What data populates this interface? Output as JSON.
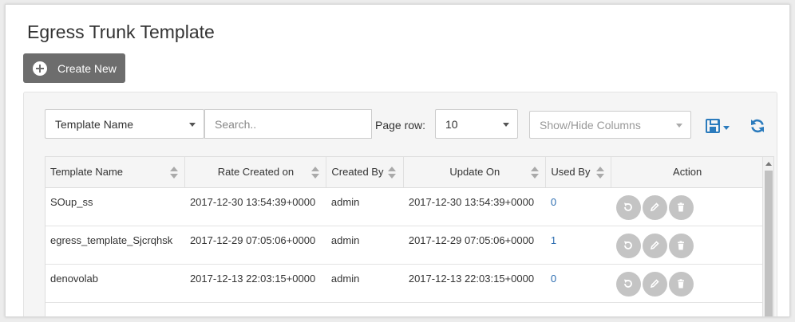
{
  "page": {
    "title": "Egress Trunk Template"
  },
  "toolbar": {
    "create_label": "Create New",
    "filter_field": "Template Name",
    "search_placeholder": "Search..",
    "page_row_label": "Page row:",
    "page_row_value": "10",
    "columns_label": "Show/Hide Columns"
  },
  "icons": {
    "create": "plus-circle-icon",
    "save": "floppy-disk-icon",
    "refresh": "refresh-icon",
    "row_actions": [
      "restore-icon",
      "pencil-icon",
      "trash-icon"
    ]
  },
  "colors": {
    "accent": "#2b7bbd",
    "link": "#2b6cb0",
    "button_dark": "#6d6d6d",
    "action_button": "#c4c4c4"
  },
  "table": {
    "headers": {
      "name": "Template Name",
      "rate_created": "Rate Created on",
      "created_by": "Created By",
      "update_on": "Update On",
      "used_by": "Used By",
      "action": "Action"
    },
    "rows": [
      {
        "name": "SOup_ss",
        "rate_created": "2017-12-30 13:54:39+0000",
        "created_by": "admin",
        "update_on": "2017-12-30 13:54:39+0000",
        "used_by": "0"
      },
      {
        "name": "egress_template_Sjcrqhsk",
        "rate_created": "2017-12-29 07:05:06+0000",
        "created_by": "admin",
        "update_on": "2017-12-29 07:05:06+0000",
        "used_by": "1"
      },
      {
        "name": "denovolab",
        "rate_created": "2017-12-13 22:03:15+0000",
        "created_by": "admin",
        "update_on": "2017-12-13 22:03:15+0000",
        "used_by": "0"
      }
    ]
  }
}
